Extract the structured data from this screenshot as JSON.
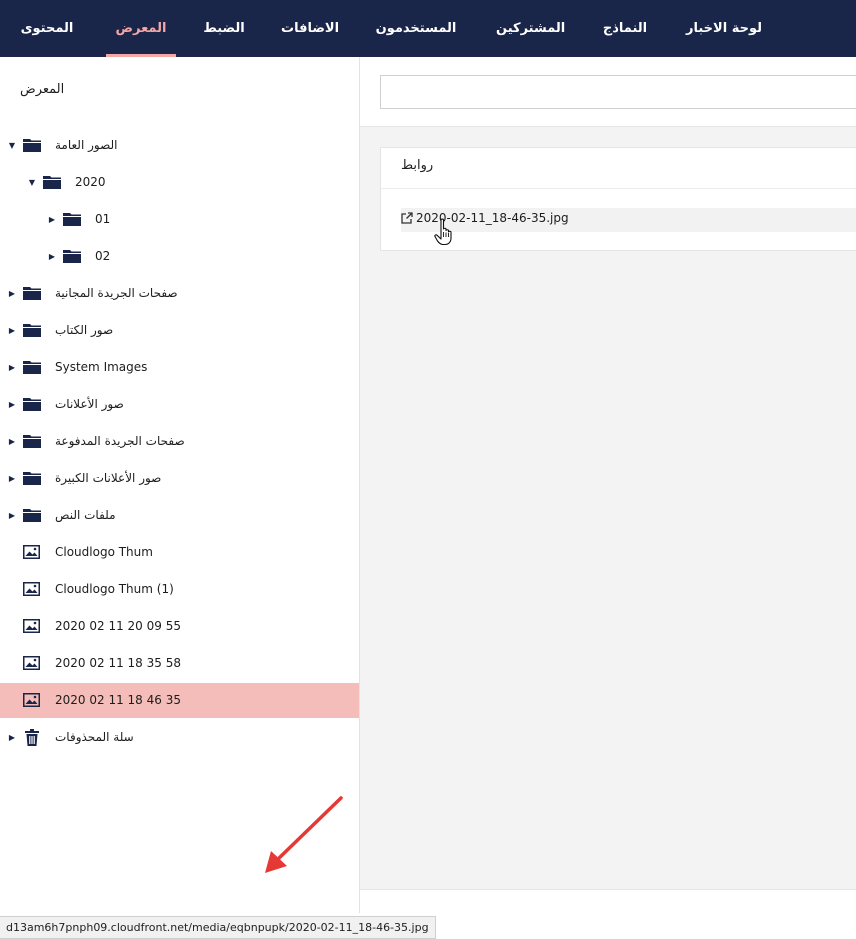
{
  "nav": {
    "tabs": [
      {
        "label": "لوحة الاخبار",
        "active": false
      },
      {
        "label": "النماذج",
        "active": false
      },
      {
        "label": "المشتركين",
        "active": false
      },
      {
        "label": "المستخدمون",
        "active": false
      },
      {
        "label": "الاضافات",
        "active": false
      },
      {
        "label": "الضبط",
        "active": false
      },
      {
        "label": "المعرض",
        "active": true
      },
      {
        "label": "المحتوى",
        "active": false
      }
    ]
  },
  "sidebar": {
    "title": "المعرض",
    "tree": [
      {
        "label": "الصور العامة",
        "icon": "folder-icon",
        "caret": "expanded",
        "level": 0
      },
      {
        "label": "2020",
        "icon": "folder-icon",
        "caret": "expanded",
        "level": 1
      },
      {
        "label": "01",
        "icon": "folder-icon",
        "caret": "collapsed",
        "level": 2
      },
      {
        "label": "02",
        "icon": "folder-icon",
        "caret": "collapsed",
        "level": 2
      },
      {
        "label": "صفحات الجريدة المجانية",
        "icon": "folder-icon",
        "caret": "collapsed",
        "level": 0
      },
      {
        "label": "صور الكتاب",
        "icon": "folder-icon",
        "caret": "collapsed",
        "level": 0
      },
      {
        "label": "System Images",
        "icon": "folder-icon",
        "caret": "collapsed",
        "level": 0
      },
      {
        "label": "صور الأعلانات",
        "icon": "folder-icon",
        "caret": "collapsed",
        "level": 0
      },
      {
        "label": "صفحات الجريدة المدفوعة",
        "icon": "folder-icon",
        "caret": "collapsed",
        "level": 0
      },
      {
        "label": "صور الأعلانات الكبيرة",
        "icon": "folder-icon",
        "caret": "collapsed",
        "level": 0
      },
      {
        "label": "ملفات النص",
        "icon": "folder-icon",
        "caret": "collapsed",
        "level": 0
      },
      {
        "label": "Cloudlogo Thum",
        "icon": "image-icon",
        "caret": "none",
        "level": 0
      },
      {
        "label": "Cloudlogo Thum (1)",
        "icon": "image-icon",
        "caret": "none",
        "level": 0
      },
      {
        "label": "2020 02 11 20 09 55",
        "icon": "image-icon",
        "caret": "none",
        "level": 0
      },
      {
        "label": "2020 02 11 18 35 58",
        "icon": "image-icon",
        "caret": "none",
        "level": 0
      },
      {
        "label": "2020 02 11 18 46 35",
        "icon": "image-icon",
        "caret": "none",
        "level": 0,
        "selected": true
      },
      {
        "label": "سلة المحذوفات",
        "icon": "trash-icon",
        "caret": "collapsed",
        "level": 0
      }
    ]
  },
  "main": {
    "search": {
      "value": "",
      "placeholder": ""
    },
    "links": {
      "title": "روابط",
      "items": [
        {
          "label": "2020-02-11_18-46-35.jpg",
          "icon": "external-link-icon"
        }
      ]
    }
  },
  "statusbar": {
    "url": "d13am6h7pnph09.cloudfront.net/media/eqbnpupk/2020-02-11_18-46-35.jpg"
  },
  "colors": {
    "nav_bg": "#1a2649",
    "nav_active": "#f3a8a8",
    "selected_row": "#f4bdb9",
    "icon": "#1a2649",
    "annotation_arrow": "#e53935"
  }
}
